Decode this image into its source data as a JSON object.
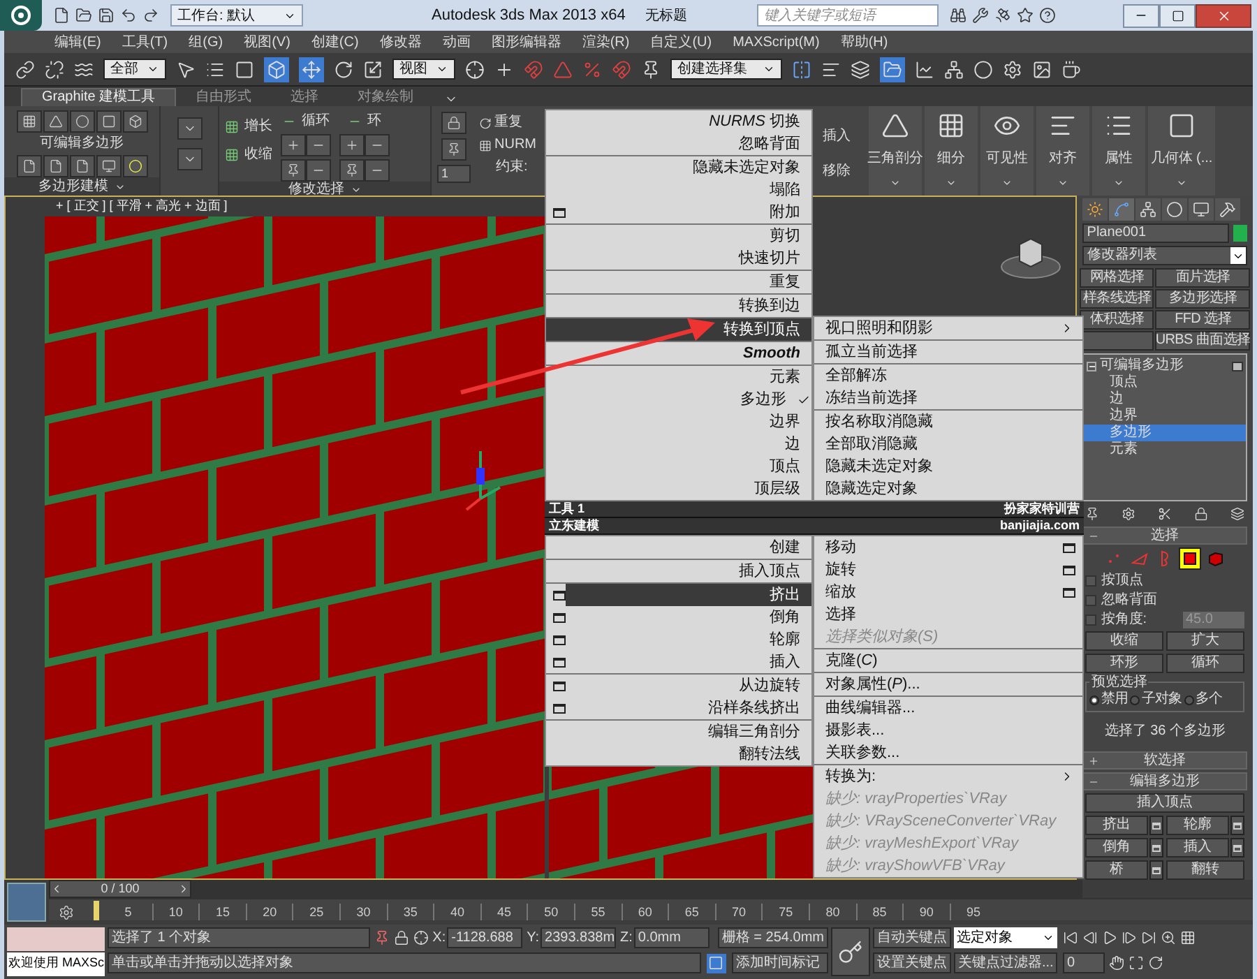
{
  "title_bar": {
    "workspace": "工作台: 默认",
    "app_title": "Autodesk 3ds Max  2013 x64",
    "document": "无标题",
    "search": {
      "placeholder": "键入关键字或短语"
    }
  },
  "menu_bar": [
    "编辑(E)",
    "工具(T)",
    "组(G)",
    "视图(V)",
    "创建(C)",
    "修改器",
    "动画",
    "图形编辑器",
    "渲染(R)",
    "自定义(U)",
    "MAXScript(M)",
    "帮助(H)"
  ],
  "main_toolbar": {
    "selection_filter": "全部",
    "reference_coord": "视图",
    "selection_set": "创建选择集"
  },
  "ribbon": {
    "tabs": [
      {
        "label": "Graphite 建模工具",
        "selected": true
      },
      {
        "label": "自由形式",
        "selected": false
      },
      {
        "label": "选择",
        "selected": false
      },
      {
        "label": "对象绘制",
        "selected": false
      }
    ],
    "polygon_group": {
      "label": "可编辑多边形",
      "footer": "多边形建模"
    },
    "modify_group": {
      "grow": "增长",
      "shrink": "收缩",
      "loop": "循环",
      "ring": "环",
      "footer": "修改选择"
    },
    "edit_group": {
      "repeat": "重复",
      "nurms": "NURM",
      "constraint": "约束:",
      "constraint_value": "1",
      "insert": "插入",
      "remove": "移除"
    },
    "big_buttons": [
      {
        "label": "三角剖分",
        "kind": "triangulate"
      },
      {
        "label": "细分",
        "kind": "subdivide"
      },
      {
        "label": "可见性",
        "kind": "visibility"
      },
      {
        "label": "对齐",
        "kind": "align"
      },
      {
        "label": "属性",
        "kind": "properties"
      },
      {
        "label": "几何体 (...",
        "kind": "geometry"
      }
    ]
  },
  "viewport": {
    "label": "+ [ 正交 ] [ 平滑 + 高光 + 边面 ]"
  },
  "quad_menu": {
    "upper_left": [
      [
        {
          "label": "*NURMS* 切换",
          "kind": "plain",
          "highlighted": false
        },
        {
          "label": "忽略背面",
          "kind": "plain",
          "highlighted": false
        }
      ],
      [
        {
          "label": "隐藏未选定对象",
          "kind": "plain",
          "highlighted": false
        },
        {
          "label": "塌陷",
          "kind": "plain",
          "highlighted": false
        },
        {
          "label": "附加",
          "kind": "settings",
          "highlighted": false
        }
      ],
      [
        {
          "label": "剪切",
          "kind": "plain",
          "highlighted": false
        },
        {
          "label": "快速切片",
          "kind": "plain",
          "highlighted": false
        }
      ],
      [
        {
          "label": "重复",
          "kind": "plain",
          "highlighted": false
        }
      ],
      [
        {
          "label": "转换到边",
          "kind": "plain",
          "highlighted": false
        }
      ],
      [
        {
          "label": "转换到顶点",
          "kind": "plain",
          "highlighted": true
        }
      ],
      [
        {
          "label": "Smooth",
          "kind": "italic",
          "highlighted": false
        }
      ],
      [
        {
          "label": "元素",
          "kind": "plain",
          "highlighted": false
        },
        {
          "label": "多边形",
          "kind": "checked",
          "highlighted": false
        },
        {
          "label": "边界",
          "kind": "plain",
          "highlighted": false
        },
        {
          "label": "边",
          "kind": "plain",
          "highlighted": false
        },
        {
          "label": "顶点",
          "kind": "plain",
          "highlighted": false
        },
        {
          "label": "顶层级",
          "kind": "plain",
          "highlighted": false
        }
      ]
    ],
    "upper_right": [
      [
        {
          "label": "视口照明和阴影",
          "kind": "submenu",
          "highlighted": false
        }
      ],
      [
        {
          "label": "孤立当前选择",
          "kind": "plain",
          "highlighted": false
        }
      ],
      [
        {
          "label": "全部解冻",
          "kind": "plain",
          "highlighted": false
        },
        {
          "label": "冻结当前选择",
          "kind": "plain",
          "highlighted": false
        }
      ],
      [
        {
          "label": "按名称取消隐藏",
          "kind": "plain",
          "highlighted": false
        },
        {
          "label": "全部取消隐藏",
          "kind": "plain",
          "highlighted": false
        },
        {
          "label": "隐藏未选定对象",
          "kind": "plain",
          "highlighted": false
        },
        {
          "label": "隐藏选定对象",
          "kind": "plain",
          "highlighted": false
        }
      ]
    ],
    "headers": [
      {
        "left": "工具 1",
        "right": "扮家家特训营"
      },
      {
        "left": "立东建模",
        "right": "banjiajia.com"
      }
    ],
    "lower_left": [
      [
        {
          "label": "创建",
          "kind": "plain",
          "highlighted": false
        }
      ],
      [
        {
          "label": "插入顶点",
          "kind": "plain",
          "highlighted": false
        }
      ],
      [
        {
          "label": "挤出",
          "kind": "settings",
          "highlighted": true
        },
        {
          "label": "倒角",
          "kind": "settings",
          "highlighted": false
        },
        {
          "label": "轮廓",
          "kind": "settings",
          "highlighted": false
        },
        {
          "label": "插入",
          "kind": "settings",
          "highlighted": false
        }
      ],
      [
        {
          "label": "从边旋转",
          "kind": "settings",
          "highlighted": false
        },
        {
          "label": "沿样条线挤出",
          "kind": "settings",
          "highlighted": false
        }
      ],
      [
        {
          "label": "编辑三角剖分",
          "kind": "plain",
          "highlighted": false
        },
        {
          "label": "翻转法线",
          "kind": "plain",
          "highlighted": false
        }
      ]
    ],
    "lower_right": [
      [
        {
          "label": "移动",
          "kind": "settings",
          "highlighted": false
        },
        {
          "label": "旋转",
          "kind": "settings",
          "highlighted": false
        },
        {
          "label": "缩放",
          "kind": "settings",
          "highlighted": false
        },
        {
          "label": "选择",
          "kind": "plain",
          "highlighted": false
        },
        {
          "label": "选择类似对象(*S*)",
          "kind": "disabled",
          "highlighted": false
        }
      ],
      [
        {
          "label": "克隆(*C*)",
          "kind": "plain",
          "highlighted": false
        }
      ],
      [
        {
          "label": "对象属性(*P*)...",
          "kind": "plain",
          "highlighted": false
        }
      ],
      [
        {
          "label": "曲线编辑器...",
          "kind": "plain",
          "highlighted": false
        },
        {
          "label": "摄影表...",
          "kind": "plain",
          "highlighted": false
        },
        {
          "label": "关联参数...",
          "kind": "plain",
          "highlighted": false
        }
      ],
      [
        {
          "label": "转换为:",
          "kind": "submenu",
          "highlighted": false
        },
        {
          "label": "缺少: *vrayProperties`VRay*",
          "kind": "disabled",
          "highlighted": false
        },
        {
          "label": "缺少: *VRaySceneConverter`VRay*",
          "kind": "disabled",
          "highlighted": false
        },
        {
          "label": "缺少: *vrayMeshExport`VRay*",
          "kind": "disabled",
          "highlighted": false
        },
        {
          "label": "缺少: *vrayShowVFB`VRay*",
          "kind": "disabled",
          "highlighted": false
        }
      ]
    ]
  },
  "command_panel": {
    "object_name": "Plane001",
    "modifier_list": "修改器列表",
    "modifier_buttons": [
      {
        "label": "网格选择",
        "kind": "button"
      },
      {
        "label": "面片选择",
        "kind": "button"
      },
      {
        "label": "样条线选择",
        "kind": "button"
      },
      {
        "label": "多边形选择",
        "kind": "button"
      },
      {
        "label": "体积选择",
        "kind": "button"
      },
      {
        "label": "FFD 选择",
        "kind": "button"
      },
      {
        "kind": "blank"
      },
      {
        "label": "URBS 曲面选择",
        "kind": "button"
      }
    ],
    "stack": {
      "label": "可编辑多边形",
      "expanded": true,
      "children": [
        {
          "label": "顶点",
          "selected": false
        },
        {
          "label": "边",
          "selected": false
        },
        {
          "label": "边界",
          "selected": false
        },
        {
          "label": "多边形",
          "selected": true
        },
        {
          "label": "元素",
          "selected": false
        }
      ]
    },
    "selection": {
      "title": "选择",
      "expanded": true,
      "levels": [
        {
          "kind": "vertex",
          "selected": false
        },
        {
          "kind": "edge",
          "selected": false
        },
        {
          "kind": "border",
          "selected": false
        },
        {
          "kind": "polygon",
          "selected": true
        },
        {
          "kind": "element",
          "selected": false
        }
      ],
      "options": [
        {
          "label": "按顶点",
          "checked": false
        },
        {
          "label": "忽略背面",
          "checked": false
        },
        {
          "label": "按角度:",
          "checked": false
        }
      ],
      "angle": "45.0",
      "buttons": [
        "收缩",
        "扩大"
      ],
      "spin_buttons": [
        "环形",
        "循环"
      ],
      "preview": {
        "title": "预览选择",
        "options": [
          {
            "label": "禁用",
            "selected": true
          },
          {
            "label": "子对象",
            "selected": false
          },
          {
            "label": "多个",
            "selected": false
          }
        ]
      },
      "status": "选择了 36 个多边形"
    },
    "soft_selection": {
      "title": "软选择",
      "expanded": false
    },
    "edit_polygons": {
      "title": "编辑多边形",
      "expanded": true,
      "insert_vertex": "插入顶点",
      "buttons": [
        {
          "label": "挤出",
          "settings": true
        },
        {
          "label": "轮廓",
          "settings": true
        },
        {
          "label": "倒角",
          "settings": true
        },
        {
          "label": "插入",
          "settings": true
        },
        {
          "label": "桥",
          "settings": true
        },
        {
          "label": "翻转",
          "settings": false
        }
      ]
    }
  },
  "timeline": {
    "frame": "0 / 100",
    "level": 0,
    "ticks": [
      "5",
      "10",
      "15",
      "20",
      "25",
      "30",
      "35",
      "40",
      "45",
      "50",
      "55",
      "60",
      "65",
      "70",
      "75",
      "80",
      "85",
      "90",
      "95"
    ]
  },
  "status_bar": {
    "listener": "欢迎使用 MAXSc",
    "selection": "选择了 1 个对象",
    "coords": [
      {
        "label": "X:",
        "value": "-1128.688"
      },
      {
        "label": "Y:",
        "value": "2393.838m"
      },
      {
        "label": "Z:",
        "value": "0.0mm"
      }
    ],
    "grid": "栅格 = 254.0mm",
    "auto_key": "自动关键点",
    "key_mode": "选定对象",
    "set_key": "设置关键点",
    "key_filters": "关键点过滤器...",
    "prompt": "单击或单击并拖动以选择对象",
    "time_tag": "添加时间标记",
    "frame": "0"
  }
}
